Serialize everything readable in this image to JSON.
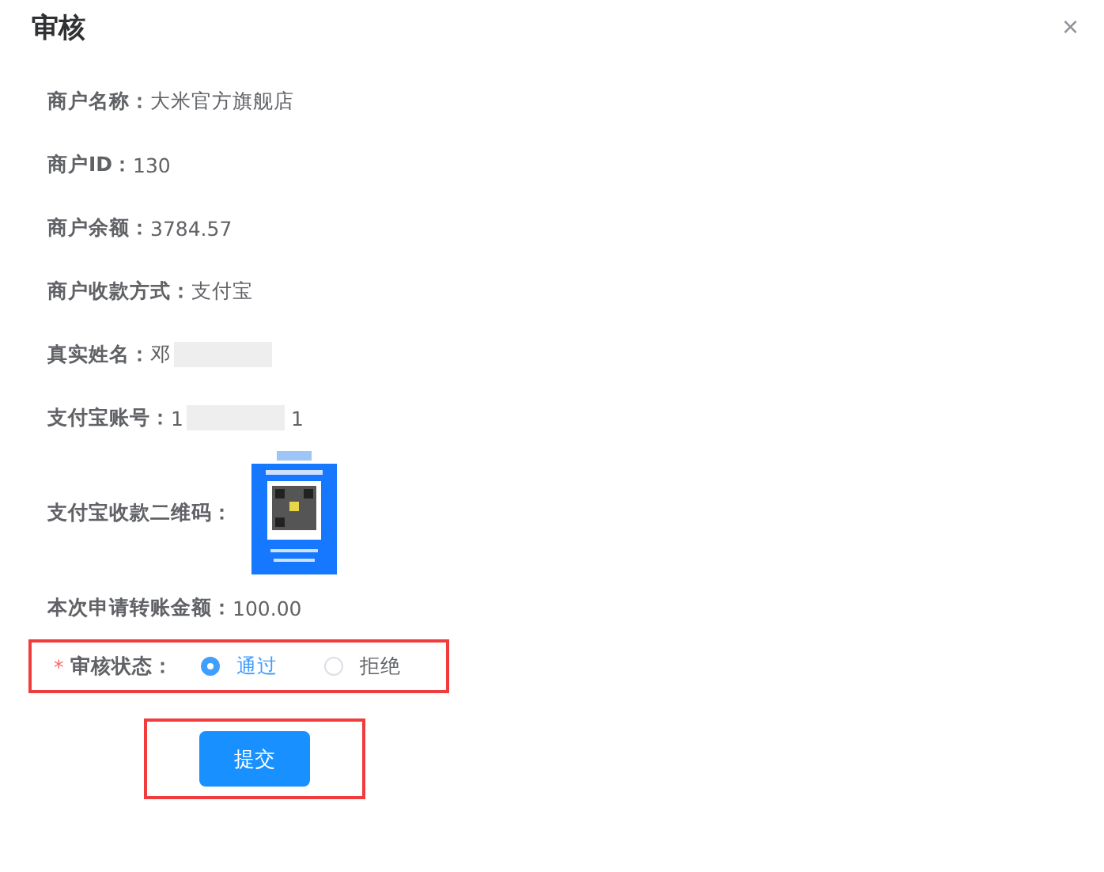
{
  "dialog": {
    "title": "审核",
    "close": "×"
  },
  "fields": [
    {
      "kind": "text",
      "label": "商户名称：",
      "value": "大米官方旗舰店"
    },
    {
      "kind": "text",
      "label": "商户ID：",
      "value": "130"
    },
    {
      "kind": "text",
      "label": "商户余额：",
      "value": "3784.57"
    },
    {
      "kind": "text",
      "label": "商户收款方式：",
      "value": "支付宝"
    },
    {
      "kind": "masked",
      "label": "真实姓名：",
      "value": "邓"
    },
    {
      "kind": "masked",
      "label": "支付宝账号：",
      "value": "1",
      "value_tail": "1"
    },
    {
      "kind": "qr",
      "label": "支付宝收款二维码："
    },
    {
      "kind": "text",
      "label": "本次申请转账金额：",
      "value": "100.00"
    }
  ],
  "status": {
    "label": "审核状态：",
    "required_mark": "*",
    "highlighted": true,
    "options": [
      {
        "label": "通过",
        "selected": true
      },
      {
        "label": "拒绝",
        "selected": false
      }
    ]
  },
  "submit": {
    "label": "提交",
    "highlighted": true
  }
}
